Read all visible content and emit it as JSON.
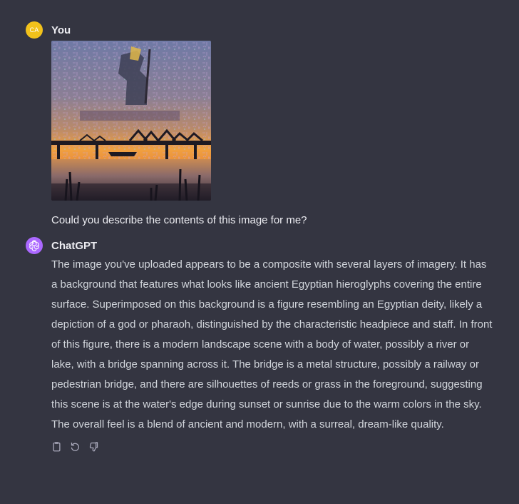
{
  "user_message": {
    "avatar_initials": "CA",
    "author": "You",
    "text": "Could you describe the contents of this image for me?"
  },
  "assistant_message": {
    "author": "ChatGPT",
    "text": "The image you've uploaded appears to be a composite with several layers of imagery. It has a background that features what looks like ancient Egyptian hieroglyphs covering the entire surface. Superimposed on this background is a figure resembling an Egyptian deity, likely a depiction of a god or pharaoh, distinguished by the characteristic headpiece and staff. In front of this figure, there is a modern landscape scene with a body of water, possibly a river or lake, with a bridge spanning across it. The bridge is a metal structure, possibly a railway or pedestrian bridge, and there are silhouettes of reeds or grass in the foreground, suggesting this scene is at the water's edge during sunset or sunrise due to the warm colors in the sky. The overall feel is a blend of ancient and modern, with a surreal, dream-like quality.",
    "actions": [
      "copy-icon",
      "regenerate-icon",
      "thumbs-down-icon"
    ]
  },
  "colors": {
    "background": "#343541",
    "user_avatar": "#f2c21b",
    "assistant_avatar": "#ab68ff",
    "text_primary": "#ececf1",
    "text_secondary": "#d1d5db",
    "icon": "#acacbe"
  }
}
